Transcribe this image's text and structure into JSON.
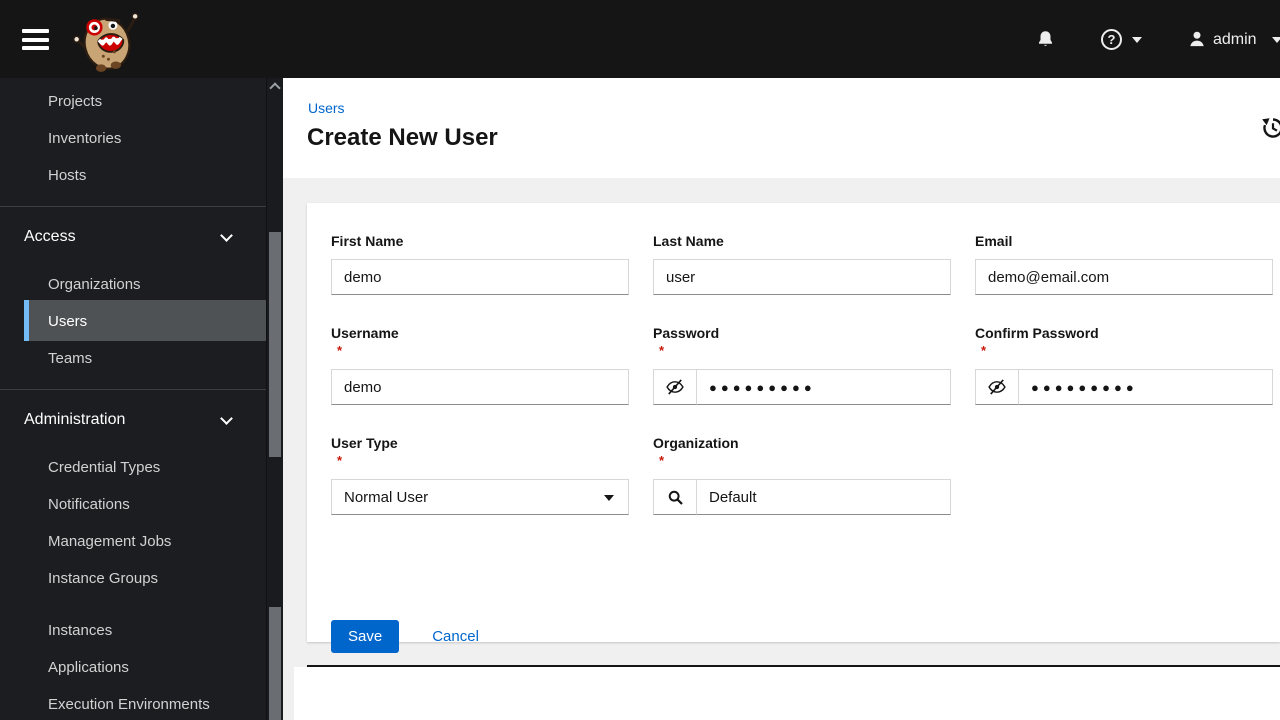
{
  "masthead": {
    "username": "admin",
    "help_glyph": "?"
  },
  "sidebar": {
    "items_top": [
      "Projects",
      "Inventories",
      "Hosts"
    ],
    "access_group": {
      "label": "Access",
      "items": [
        "Organizations",
        "Users",
        "Teams"
      ]
    },
    "admin_group": {
      "label": "Administration",
      "items": [
        "Credential Types",
        "Notifications",
        "Management Jobs",
        "Instance Groups"
      ]
    },
    "items_bottom": [
      "Instances",
      "Applications",
      "Execution Environments"
    ],
    "selected_item": "Users"
  },
  "page": {
    "breadcrumb": "Users",
    "title": "Create New User"
  },
  "form": {
    "first_name": {
      "label": "First Name",
      "value": "demo"
    },
    "last_name": {
      "label": "Last Name",
      "value": "user"
    },
    "email": {
      "label": "Email",
      "value": "demo@email.com"
    },
    "username": {
      "label": "Username",
      "value": "demo",
      "required": "*"
    },
    "password": {
      "label": "Password",
      "masked_value": "●●●●●●●●●",
      "required": "*"
    },
    "confirm_password": {
      "label": "Confirm Password",
      "masked_value": "●●●●●●●●●",
      "required": "*"
    },
    "user_type": {
      "label": "User Type",
      "value": "Normal User",
      "required": "*"
    },
    "organization": {
      "label": "Organization",
      "value": "Default",
      "required": "*"
    },
    "save_label": "Save",
    "cancel_label": "Cancel"
  },
  "colors": {
    "accent": "#0066cc",
    "masthead_bg": "#151515",
    "sidebar_bg": "#1b1d21",
    "selected_bg": "#4f5255",
    "selected_border": "#73bcf7",
    "required_red": "#c9190b",
    "page_bg": "#f0f0f0"
  }
}
